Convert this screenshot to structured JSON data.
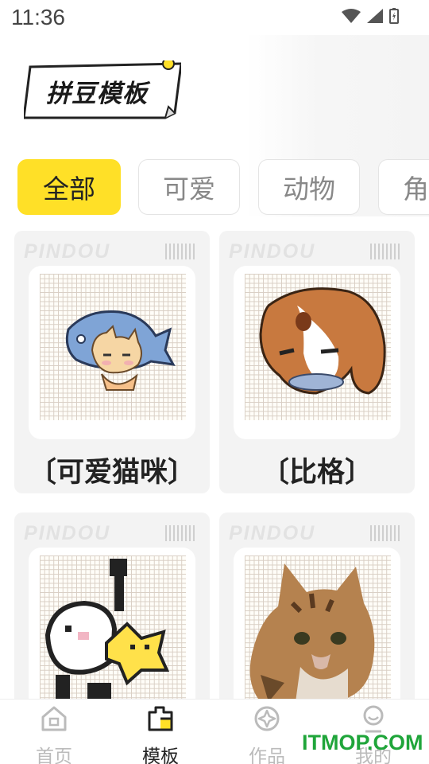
{
  "status_bar": {
    "time": "11:36"
  },
  "header": {
    "title": "拼豆模板"
  },
  "categories": [
    {
      "label": "全部",
      "active": true
    },
    {
      "label": "可爱",
      "active": false
    },
    {
      "label": "动物",
      "active": false
    },
    {
      "label": "角",
      "active": false
    }
  ],
  "cards": [
    {
      "brand": "PINDOU",
      "title": "〔可爱猫咪〕"
    },
    {
      "brand": "PINDOU",
      "title": "〔比格〕"
    },
    {
      "brand": "PINDOU",
      "title": ""
    },
    {
      "brand": "PINDOU",
      "title": ""
    }
  ],
  "nav": [
    {
      "label": "首页",
      "icon": "home-icon",
      "active": false
    },
    {
      "label": "模板",
      "icon": "template-icon",
      "active": true
    },
    {
      "label": "作品",
      "icon": "works-icon",
      "active": false
    },
    {
      "label": "我的",
      "icon": "profile-icon",
      "active": false
    }
  ],
  "watermark": "ITMOP.COM",
  "colors": {
    "accent": "#ffe027",
    "nav_inactive": "#bbbbbb",
    "watermark": "#1fa53a"
  }
}
